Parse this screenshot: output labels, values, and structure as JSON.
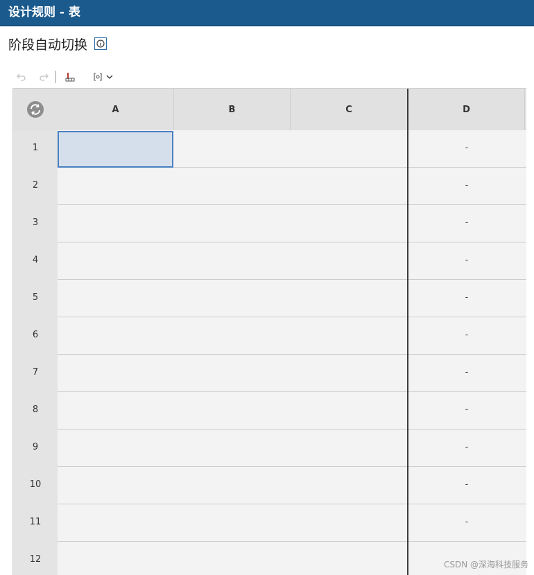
{
  "window": {
    "title": "设计规则 - 表"
  },
  "page": {
    "heading": "阶段自动切换"
  },
  "toolbar": {
    "undo_icon": "undo-icon",
    "redo_icon": "redo-icon",
    "table_tool_icon": "table-tool-icon",
    "formula_icon": "formula-icon",
    "dropdown_icon": "chevron-down-icon"
  },
  "grid": {
    "columns": [
      "A",
      "B",
      "C",
      "D"
    ],
    "rows": [
      {
        "num": "1",
        "d": "-"
      },
      {
        "num": "2",
        "d": "-"
      },
      {
        "num": "3",
        "d": "-"
      },
      {
        "num": "4",
        "d": "-"
      },
      {
        "num": "5",
        "d": "-"
      },
      {
        "num": "6",
        "d": "-"
      },
      {
        "num": "7",
        "d": "-"
      },
      {
        "num": "8",
        "d": "-"
      },
      {
        "num": "9",
        "d": "-"
      },
      {
        "num": "10",
        "d": "-"
      },
      {
        "num": "11",
        "d": "-"
      },
      {
        "num": "12",
        "d": ""
      }
    ]
  },
  "colors": {
    "titlebar": "#1b5a8c",
    "selection_border": "#4a7fc1",
    "selection_fill": "#d5dfeb"
  },
  "watermark": "CSDN @深海科技服务"
}
